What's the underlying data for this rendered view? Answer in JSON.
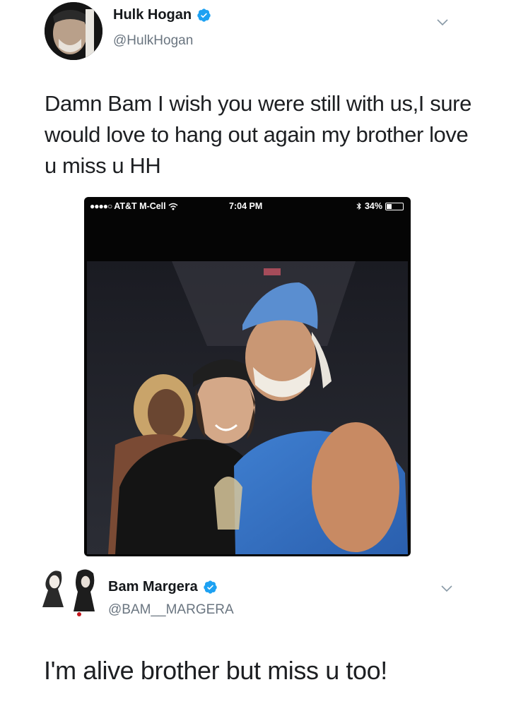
{
  "tweet": {
    "author": {
      "display_name": "Hulk Hogan",
      "handle": "@HulkHogan",
      "verified": true
    },
    "text": "Damn  Bam I wish you were still with us,I sure would love to hang out again my brother love u miss u HH",
    "screenshot": {
      "status_bar": {
        "signal_dots": "●●●●○",
        "carrier": "AT&T M-Cell",
        "time": "7:04 PM",
        "battery": "34%",
        "battery_level": 0.34
      }
    }
  },
  "reply": {
    "author": {
      "display_name": "Bam Margera",
      "handle": "@BAM__MARGERA",
      "verified": true
    },
    "text": "I'm alive brother but miss u too!"
  },
  "colors": {
    "verified_blue": "#1da1f2",
    "text": "#1d1f22",
    "handle_gray": "#6a7580",
    "chevron": "#8899a6"
  }
}
